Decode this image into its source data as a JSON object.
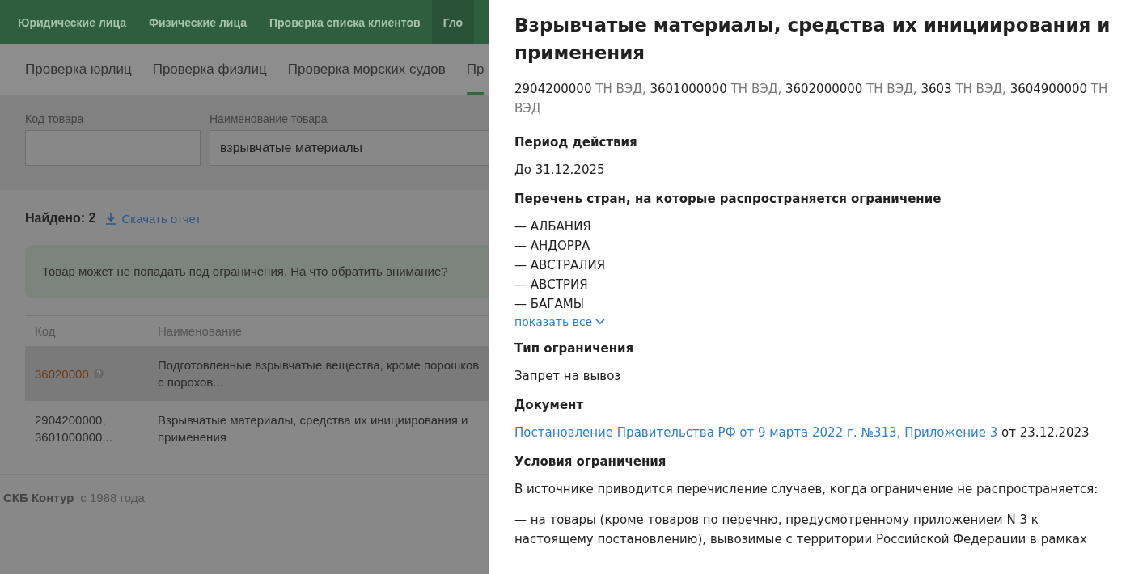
{
  "top_nav": [
    {
      "label": "Юридические лица",
      "selected": false
    },
    {
      "label": "Физические лица",
      "selected": false
    },
    {
      "label": "Проверка списка клиентов",
      "selected": false
    },
    {
      "label": "Гло",
      "selected": true
    }
  ],
  "sub_tabs": [
    {
      "label": "Проверка юрлиц",
      "selected": false
    },
    {
      "label": "Проверка физлиц",
      "selected": false
    },
    {
      "label": "Проверка морских судов",
      "selected": false
    },
    {
      "label": "Пр",
      "selected": true
    }
  ],
  "search_form": {
    "fields": [
      {
        "label": "Код товара"
      },
      {
        "label": "Наименование товара",
        "value": "взрывчатые материалы"
      }
    ]
  },
  "results": {
    "found": "Найдено: 2",
    "download_link": "Скачать отчет",
    "notice": "Товар может не попадать под ограничения. На что обратить внимание?",
    "table": {
      "columns": [
        "Код",
        "Наименование"
      ],
      "rows": [
        {
          "code": "36020000",
          "flagged": true,
          "selected": true,
          "name": "Подготовленные взрывчатые вещества, кроме порошков с порохов..."
        },
        {
          "code": "2904200000, 3601000000...",
          "flagged": false,
          "selected": false,
          "name": "Взрывчатые материалы, средства их инициирования и применения"
        }
      ]
    }
  },
  "footer": {
    "brand": "СКБ Контур",
    "since": "с 1988 года"
  },
  "drawer": {
    "title": "Взрывчатые материалы, средства их инициирования и применения",
    "codes": [
      {
        "code": "2904200000",
        "unit": "ТН ВЭД,"
      },
      {
        "code": "3601000000",
        "unit": "ТН ВЭД,"
      },
      {
        "code": "3602000000",
        "unit": "ТН ВЭД,"
      },
      {
        "code": "3603",
        "unit": "ТН ВЭД,"
      },
      {
        "code": "3604900000",
        "unit": "ТН ВЭД"
      }
    ],
    "sections": [
      {
        "kind": "text",
        "heading": "Период действия",
        "text": "До 31.12.2025"
      },
      {
        "kind": "list",
        "heading": "Перечень стран, на которые распространяется ограничение",
        "items": [
          "— АЛБАНИЯ",
          "— АНДОРРА",
          "— АВСТРАЛИЯ",
          "— АВСТРИЯ",
          "— БАГАМЫ"
        ],
        "more": "показать все"
      },
      {
        "kind": "text",
        "heading": "Тип ограничения",
        "text": "Запрет на вывоз"
      },
      {
        "kind": "link",
        "heading": "Документ",
        "link": "Постановление Правительства РФ от 9 марта 2022 г. №313, Приложение 3",
        "text": "от 23.12.2023"
      },
      {
        "kind": "paragraphs",
        "heading": "Условия ограничения",
        "paragraphs": [
          "В источнике приводится перечисление случаев, когда ограничение не распространяется:",
          "— на товары (кроме товаров по перечню, предусмотренному приложением N 3 к настоящему постановлению), вывозимые с территории Российской Федерации в рамках"
        ]
      }
    ]
  }
}
